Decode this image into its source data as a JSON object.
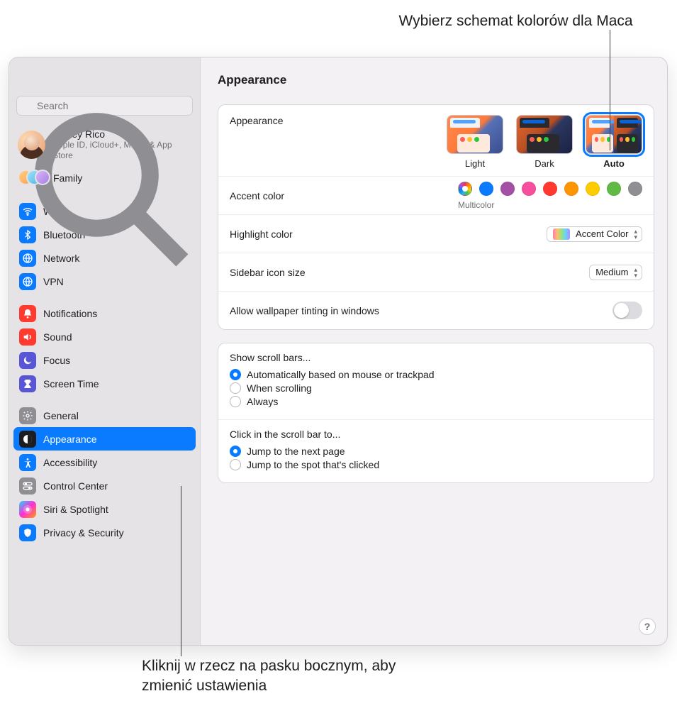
{
  "callouts": {
    "top": "Wybierz schemat kolorów dla Maca",
    "bottom": "Kliknij w rzecz na pasku bocznym, aby zmienić ustawienia"
  },
  "search": {
    "placeholder": "Search"
  },
  "user": {
    "name": "Ashley Rico",
    "sub": "Apple ID, iCloud+, Media & App Store"
  },
  "family_label": "Family",
  "sidebar": {
    "g1": [
      {
        "id": "wifi",
        "label": "Wi-Fi",
        "color": "blue"
      },
      {
        "id": "bluetooth",
        "label": "Bluetooth",
        "color": "blue"
      },
      {
        "id": "network",
        "label": "Network",
        "color": "blue"
      },
      {
        "id": "vpn",
        "label": "VPN",
        "color": "blue"
      }
    ],
    "g2": [
      {
        "id": "notifications",
        "label": "Notifications",
        "color": "red"
      },
      {
        "id": "sound",
        "label": "Sound",
        "color": "red"
      },
      {
        "id": "focus",
        "label": "Focus",
        "color": "purple"
      },
      {
        "id": "screentime",
        "label": "Screen Time",
        "color": "purple"
      }
    ],
    "g3": [
      {
        "id": "general",
        "label": "General",
        "color": "gray"
      },
      {
        "id": "appearance",
        "label": "Appearance",
        "color": "black"
      },
      {
        "id": "accessibility",
        "label": "Accessibility",
        "color": "blue"
      },
      {
        "id": "controlcenter",
        "label": "Control Center",
        "color": "gray"
      },
      {
        "id": "siri",
        "label": "Siri & Spotlight",
        "color": "siri"
      },
      {
        "id": "privacy",
        "label": "Privacy & Security",
        "color": "blue"
      }
    ]
  },
  "page_title": "Appearance",
  "appearance": {
    "label": "Appearance",
    "thumbs": [
      {
        "id": "light",
        "label": "Light"
      },
      {
        "id": "dark",
        "label": "Dark"
      },
      {
        "id": "auto",
        "label": "Auto"
      }
    ],
    "selected": "auto"
  },
  "accent": {
    "label": "Accent color",
    "sublabel": "Multicolor",
    "colors": [
      "multi",
      "#0a7aff",
      "#a550a7",
      "#f74f9e",
      "#ff3830",
      "#ff9500",
      "#ffcc00",
      "#62ba46",
      "#8e8e93"
    ]
  },
  "highlight": {
    "label": "Highlight color",
    "value": "Accent Color"
  },
  "sidebar_icon": {
    "label": "Sidebar icon size",
    "value": "Medium"
  },
  "tinting": {
    "label": "Allow wallpaper tinting in windows",
    "on": false
  },
  "scroll": {
    "title": "Show scroll bars...",
    "opts": [
      "Automatically based on mouse or trackpad",
      "When scrolling",
      "Always"
    ],
    "selected": 0
  },
  "click_scroll": {
    "title": "Click in the scroll bar to...",
    "opts": [
      "Jump to the next page",
      "Jump to the spot that's clicked"
    ],
    "selected": 0
  }
}
